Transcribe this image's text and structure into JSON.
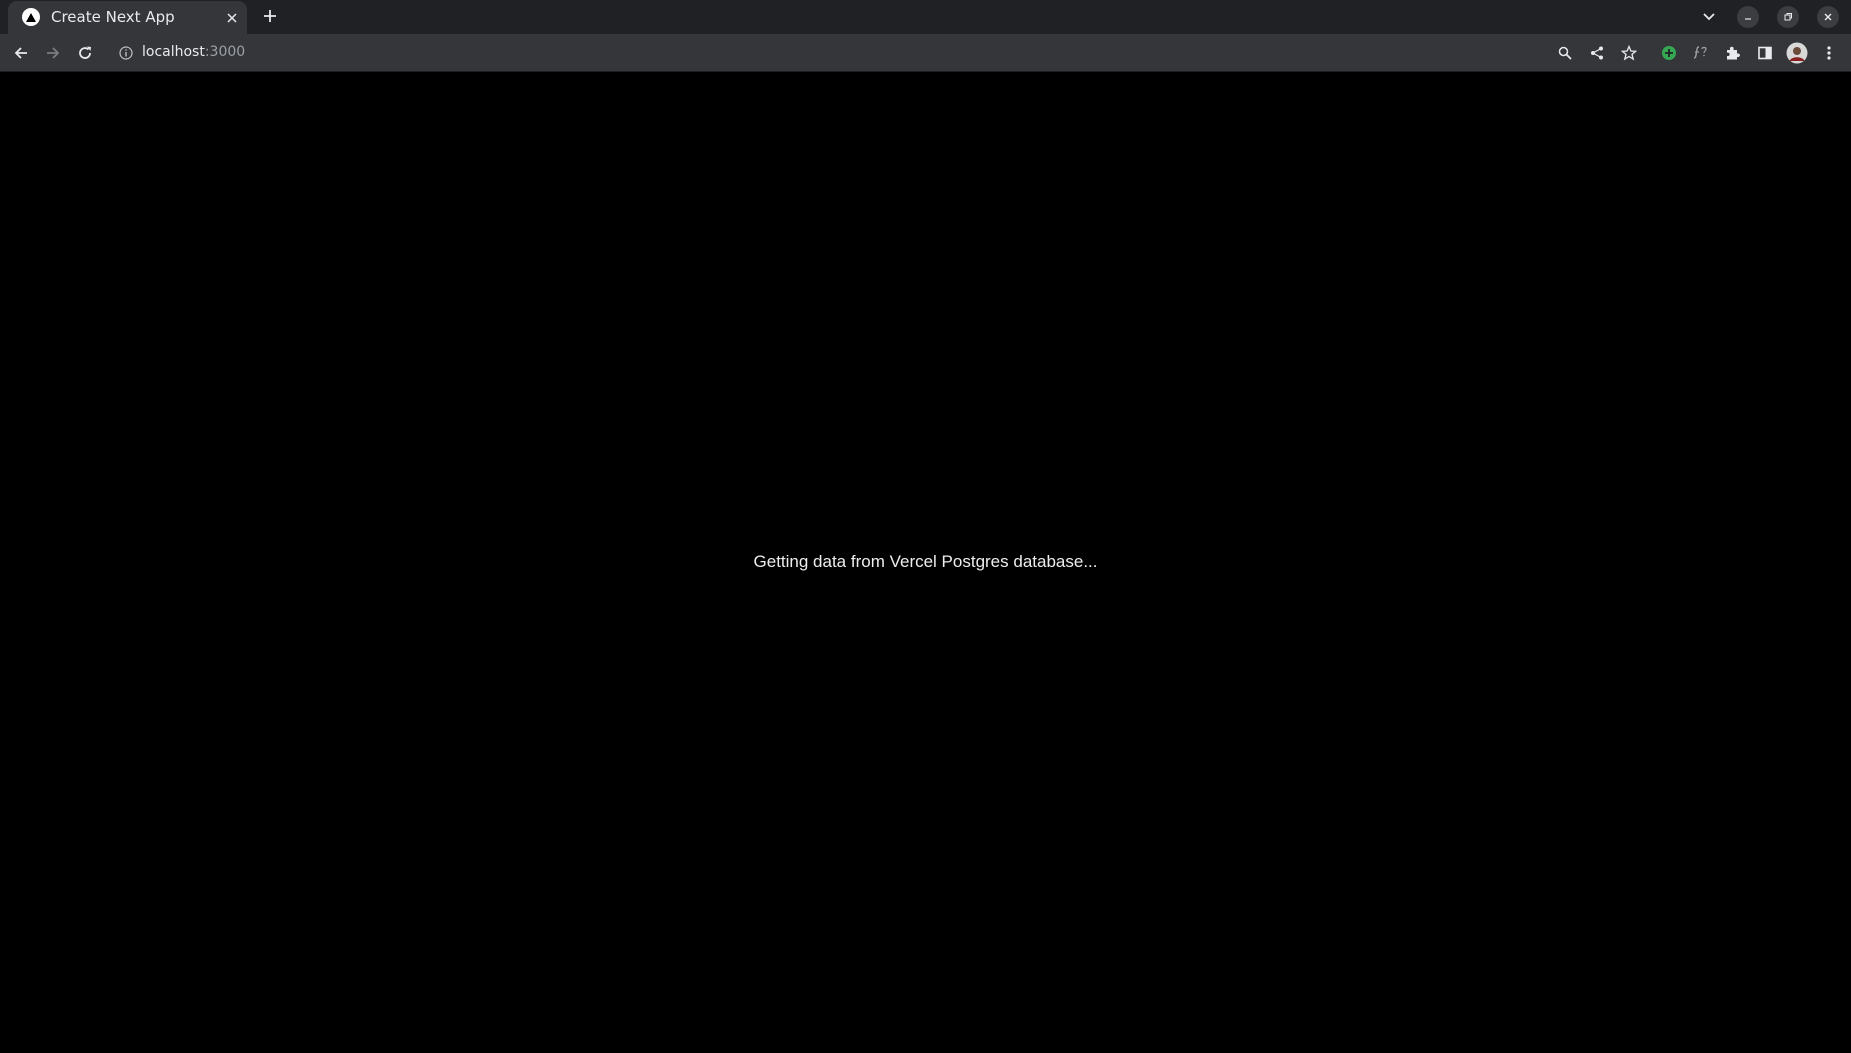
{
  "tab": {
    "title": "Create Next App"
  },
  "toolbar": {
    "url_host": "localhost",
    "url_port": ":3000"
  },
  "page": {
    "message": "Getting data from Vercel Postgres database..."
  },
  "icons": {
    "favicon": "nextjs-triangle-icon",
    "tab_close": "close-icon",
    "new_tab": "plus-icon",
    "tab_search": "chevron-down-icon",
    "back": "arrow-left-icon",
    "forward": "arrow-right-icon",
    "reload": "reload-icon",
    "site_info": "info-icon",
    "zoom": "search-icon",
    "share": "share-icon",
    "bookmark": "star-icon",
    "extension_plus": "plus-circle-icon",
    "extension_formula": "formula-icon",
    "extensions": "puzzle-icon",
    "side_panel": "side-panel-icon",
    "profile": "avatar",
    "menu": "kebab-menu-icon"
  },
  "colors": {
    "tabstrip_bg": "#202124",
    "toolbar_bg": "#35363a",
    "page_bg": "#000000",
    "text": "#ededed",
    "extension_accent": "#34a853"
  }
}
